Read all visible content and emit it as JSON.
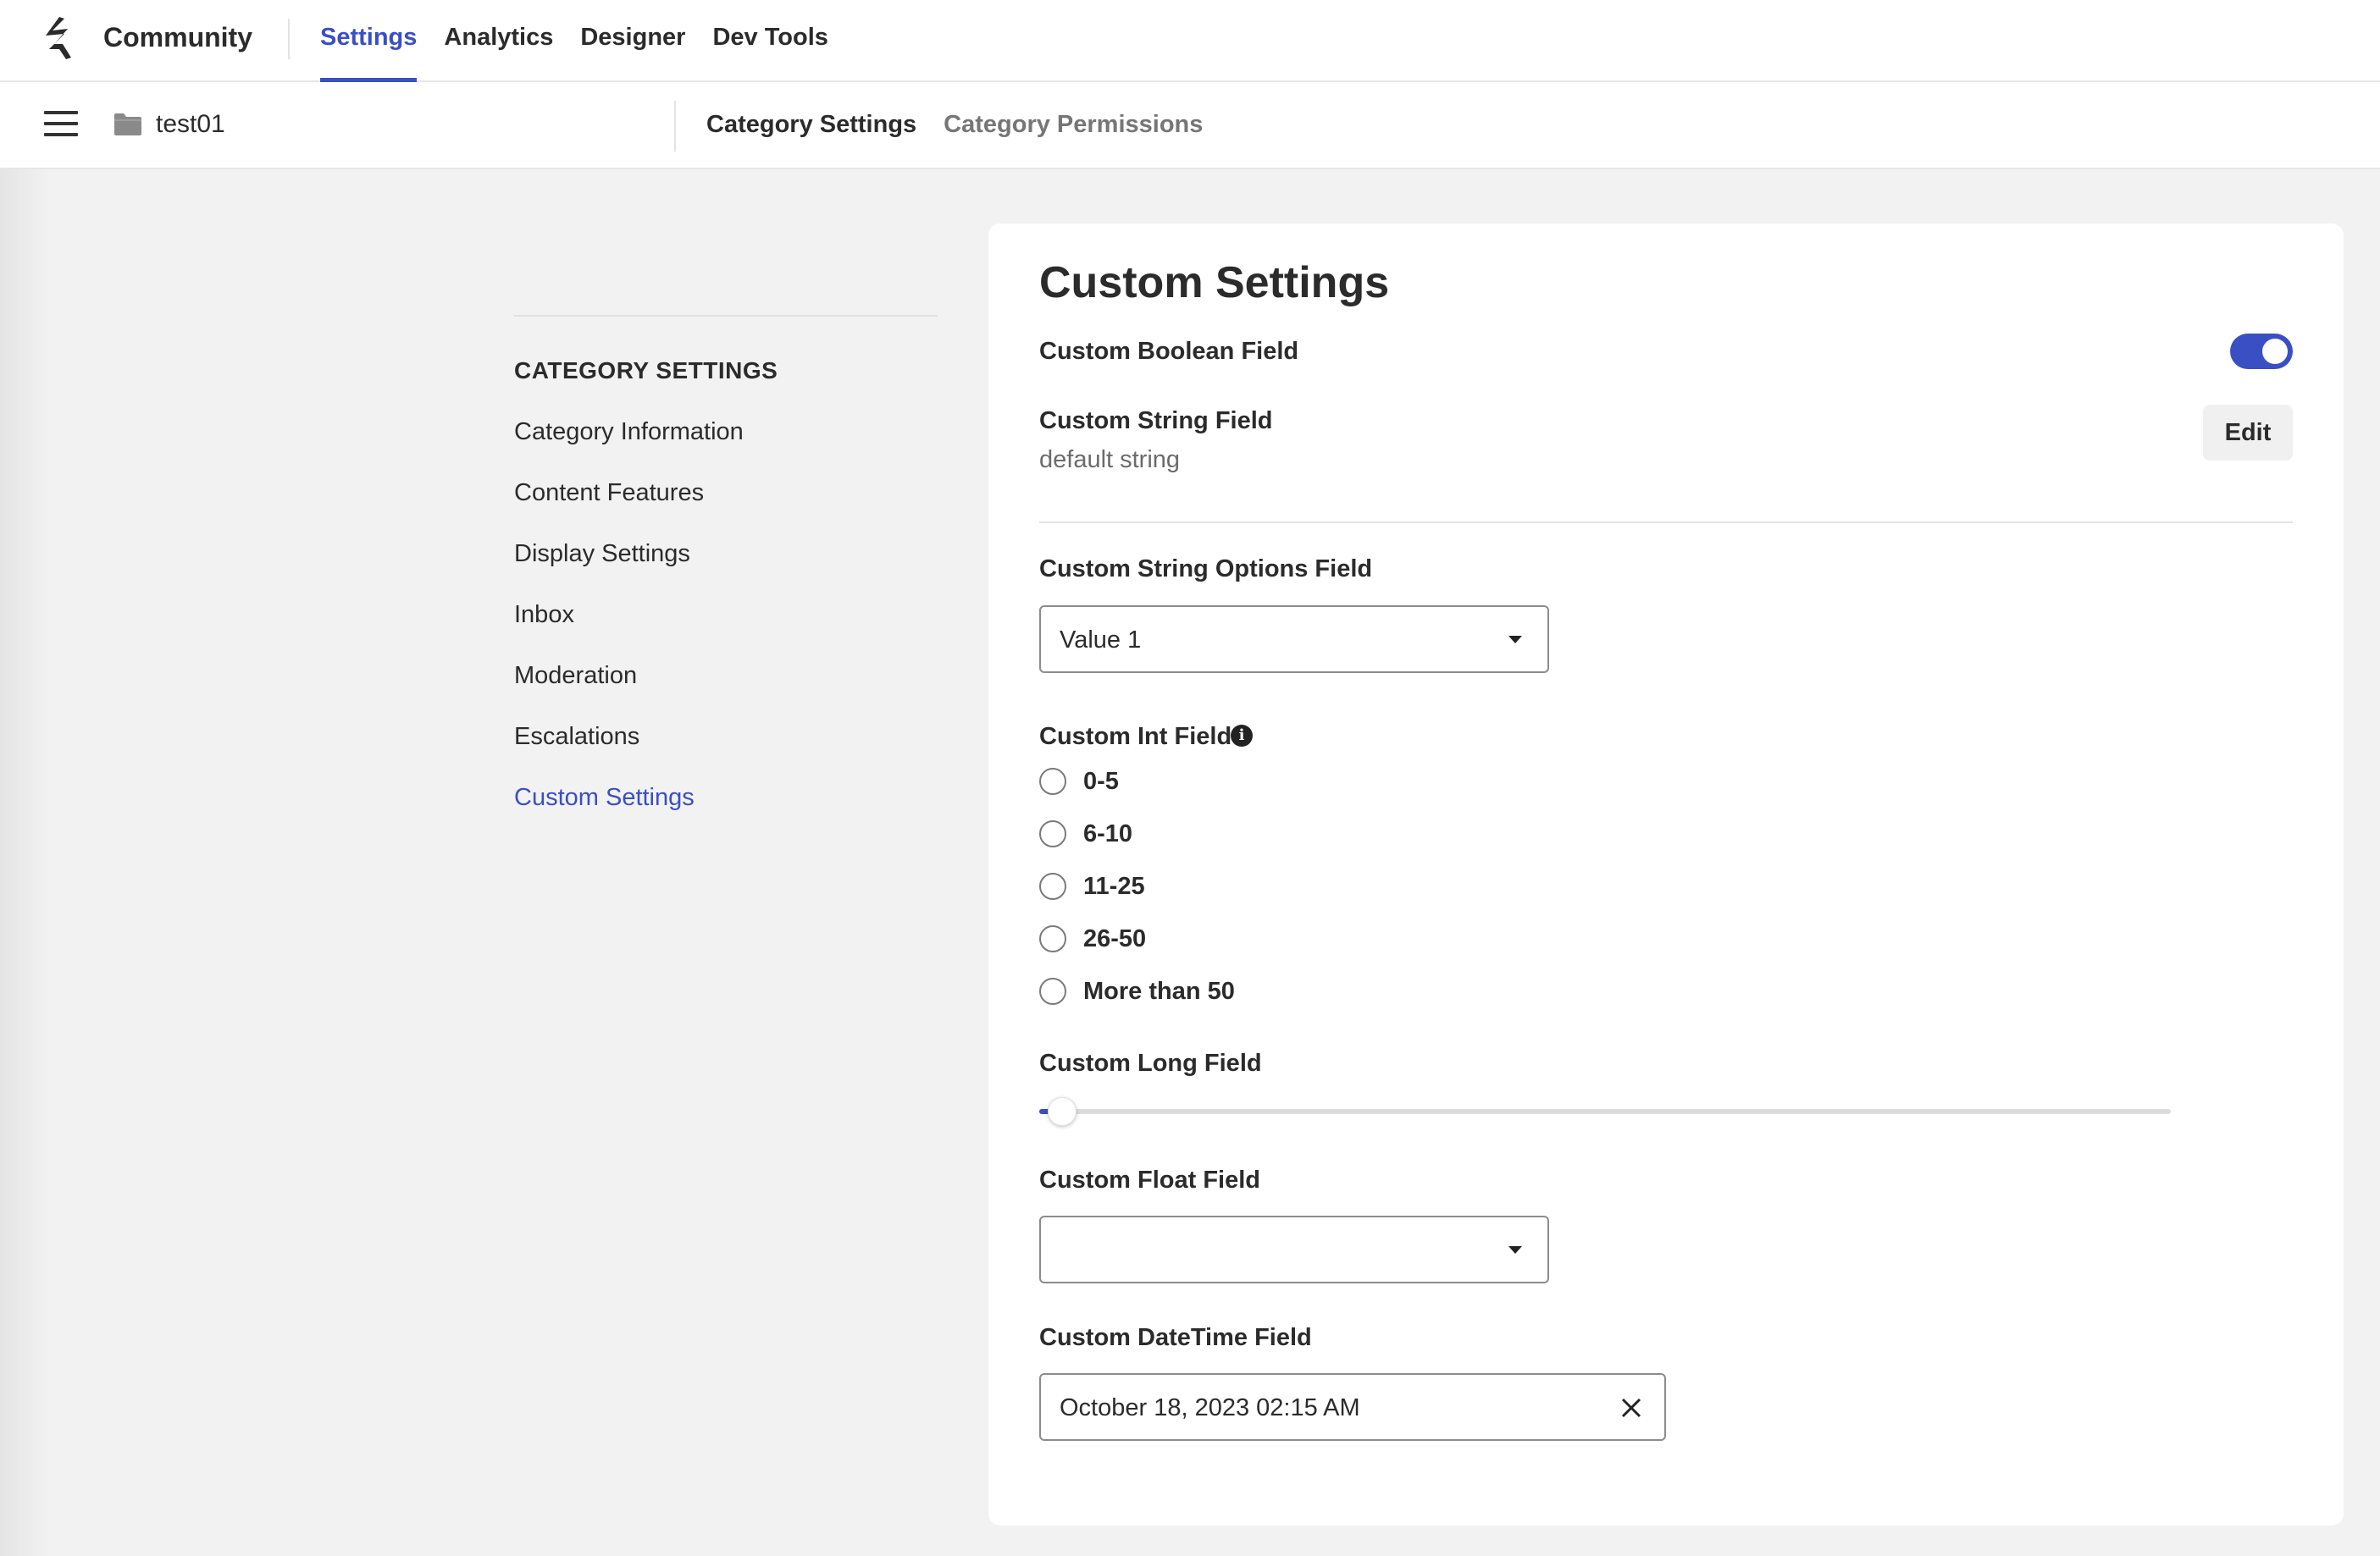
{
  "topbar": {
    "brand": "Community",
    "tabs": [
      {
        "label": "Settings",
        "active": true
      },
      {
        "label": "Analytics",
        "active": false
      },
      {
        "label": "Designer",
        "active": false
      },
      {
        "label": "Dev Tools",
        "active": false
      }
    ]
  },
  "subbar": {
    "breadcrumb": "test01",
    "tabs": [
      {
        "label": "Category Settings",
        "active": true
      },
      {
        "label": "Category Permissions",
        "active": false
      }
    ]
  },
  "sidenav": {
    "heading": "CATEGORY SETTINGS",
    "items": [
      {
        "label": "Category Information",
        "active": false
      },
      {
        "label": "Content Features",
        "active": false
      },
      {
        "label": "Display Settings",
        "active": false
      },
      {
        "label": "Inbox",
        "active": false
      },
      {
        "label": "Moderation",
        "active": false
      },
      {
        "label": "Escalations",
        "active": false
      },
      {
        "label": "Custom Settings",
        "active": true
      }
    ]
  },
  "main": {
    "title": "Custom Settings",
    "boolean_field": {
      "label": "Custom Boolean Field",
      "value": true
    },
    "string_field": {
      "label": "Custom String Field",
      "value": "default string",
      "edit_label": "Edit"
    },
    "string_options_field": {
      "label": "Custom String Options Field",
      "value": "Value 1"
    },
    "int_field": {
      "label": "Custom Int Field",
      "info_glyph": "i",
      "options": [
        "0-5",
        "6-10",
        "11-25",
        "26-50",
        "More than 50"
      ],
      "selected": null
    },
    "long_field": {
      "label": "Custom Long Field",
      "value_fraction": 0.02
    },
    "float_field": {
      "label": "Custom Float Field",
      "value": ""
    },
    "datetime_field": {
      "label": "Custom DateTime Field",
      "value": "October 18, 2023 02:15 AM"
    }
  },
  "colors": {
    "accent": "#3a4fc4",
    "background": "#f2f2f2",
    "card": "#ffffff"
  },
  "icons": [
    "logo-icon",
    "hamburger-icon",
    "folder-icon",
    "info-icon",
    "caret-down-icon",
    "close-icon"
  ]
}
